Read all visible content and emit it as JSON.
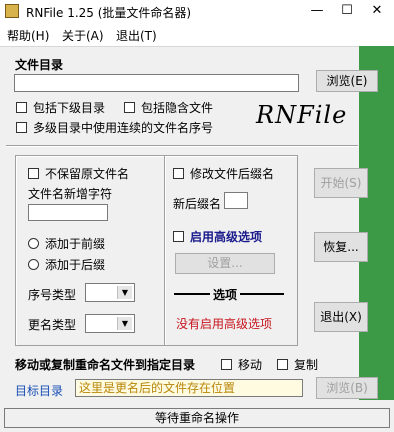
{
  "window": {
    "title": "RNFile 1.25   (批量文件命名器)",
    "minimize": "—",
    "maximize": "☐",
    "close": "✕"
  },
  "menu": [
    "帮助(H)",
    "关于(A)",
    "退出(T)"
  ],
  "directory": {
    "label": "文件目录",
    "path": "",
    "browse": "浏览(E)",
    "include_subdirs": "包括下级目录",
    "include_hidden": "包括隐含文件",
    "multi_dir_seq": "多级目录中使用连续的文件名序号",
    "logo_text": "RNFile"
  },
  "left_panel": {
    "keep_original": "不保留原文件名",
    "new_char_label": "文件名新增字符",
    "new_char_value": "",
    "add_before": "添加于前缀",
    "add_after": "添加于后缀",
    "seq_type_label": "序号类型",
    "rename_type_label": "更名类型"
  },
  "middle_panel": {
    "modify_ext": "修改文件后缀名",
    "new_ext_label": "新后缀名",
    "new_ext_value": "",
    "enable_advanced": "启用高级选项",
    "settings": "设置...",
    "options_title": "选项",
    "advanced_status": "没有启用高级选项"
  },
  "actions": {
    "start": "开始(S)",
    "restore": "恢复...",
    "exit": "退出(X)"
  },
  "move_copy": {
    "label": "移动或复制重命名文件到指定目录",
    "move": "移动",
    "copy": "复制",
    "target_label": "目标目录",
    "target_placeholder": "这里是更名后的文件存在位置",
    "browse": "浏览(B)"
  },
  "status": "等待重命名操作",
  "colors": {
    "accent_green": "#3c9a46",
    "target_label_blue": "#1a4fb5",
    "status_red": "#c8141e",
    "placeholder_yellow": "#fffbe0"
  }
}
